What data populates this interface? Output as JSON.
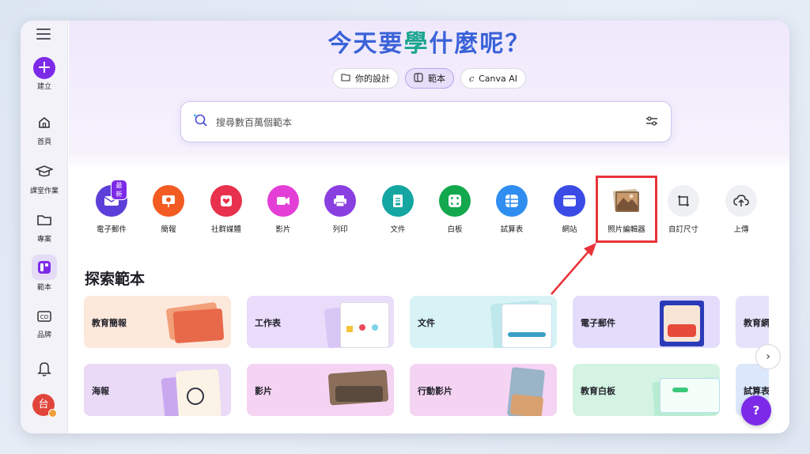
{
  "hero": {
    "title_a": "今天要",
    "title_b": "學",
    "title_c": "什麼呢？"
  },
  "pills": [
    {
      "label": "你的設計",
      "icon": "folder-icon",
      "active": false
    },
    {
      "label": "範本",
      "icon": "template-icon",
      "active": true
    },
    {
      "label": "Canva AI",
      "icon": "canva-ai-icon",
      "active": false
    }
  ],
  "search": {
    "placeholder": "搜尋數百萬個範本"
  },
  "sidebar": {
    "items": [
      {
        "label": "建立"
      },
      {
        "label": "首頁"
      },
      {
        "label": "課堂作業"
      },
      {
        "label": "專案"
      },
      {
        "label": "範本"
      },
      {
        "label": "品牌"
      }
    ],
    "avatar": "台"
  },
  "categories": [
    {
      "label": "電子郵件",
      "icon": "email-icon",
      "color": "#5b3fd8",
      "badge": "最新"
    },
    {
      "label": "簡報",
      "icon": "presentation-icon",
      "color": "#f25c22"
    },
    {
      "label": "社群媒體",
      "icon": "heart-icon",
      "color": "#e8314c"
    },
    {
      "label": "影片",
      "icon": "video-icon",
      "color": "#e33fd6"
    },
    {
      "label": "列印",
      "icon": "printer-icon",
      "color": "#8a3fe0"
    },
    {
      "label": "文件",
      "icon": "document-icon",
      "color": "#14a6a0"
    },
    {
      "label": "白板",
      "icon": "whiteboard-icon",
      "color": "#13a84d"
    },
    {
      "label": "試算表",
      "icon": "spreadsheet-icon",
      "color": "#2f8ef0"
    },
    {
      "label": "網站",
      "icon": "website-icon",
      "color": "#3a4be6"
    },
    {
      "label": "照片編輯器",
      "icon": "photo-editor-icon",
      "color": "#b88a5c"
    },
    {
      "label": "自訂尺寸",
      "icon": "custom-size-icon",
      "color": "#eef0f3"
    },
    {
      "label": "上傳",
      "icon": "upload-icon",
      "color": "#eef0f3"
    }
  ],
  "section": {
    "title": "探索範本"
  },
  "templates": [
    {
      "label": "教育簡報",
      "bg": "#fde8dc"
    },
    {
      "label": "工作表",
      "bg": "#eadcfb"
    },
    {
      "label": "文件",
      "bg": "#d7f3f5"
    },
    {
      "label": "電子郵件",
      "bg": "#e4dcfb"
    },
    {
      "label": "教育網",
      "bg": "#e6e2fb"
    },
    {
      "label": "海報",
      "bg": "#ead9f7"
    },
    {
      "label": "影片",
      "bg": "#f5d4f3"
    },
    {
      "label": "行動影片",
      "bg": "#f5d4f3"
    },
    {
      "label": "教育白板",
      "bg": "#d4f3e3"
    },
    {
      "label": "試算表",
      "bg": "#dbe7fb"
    }
  ],
  "help": "?"
}
